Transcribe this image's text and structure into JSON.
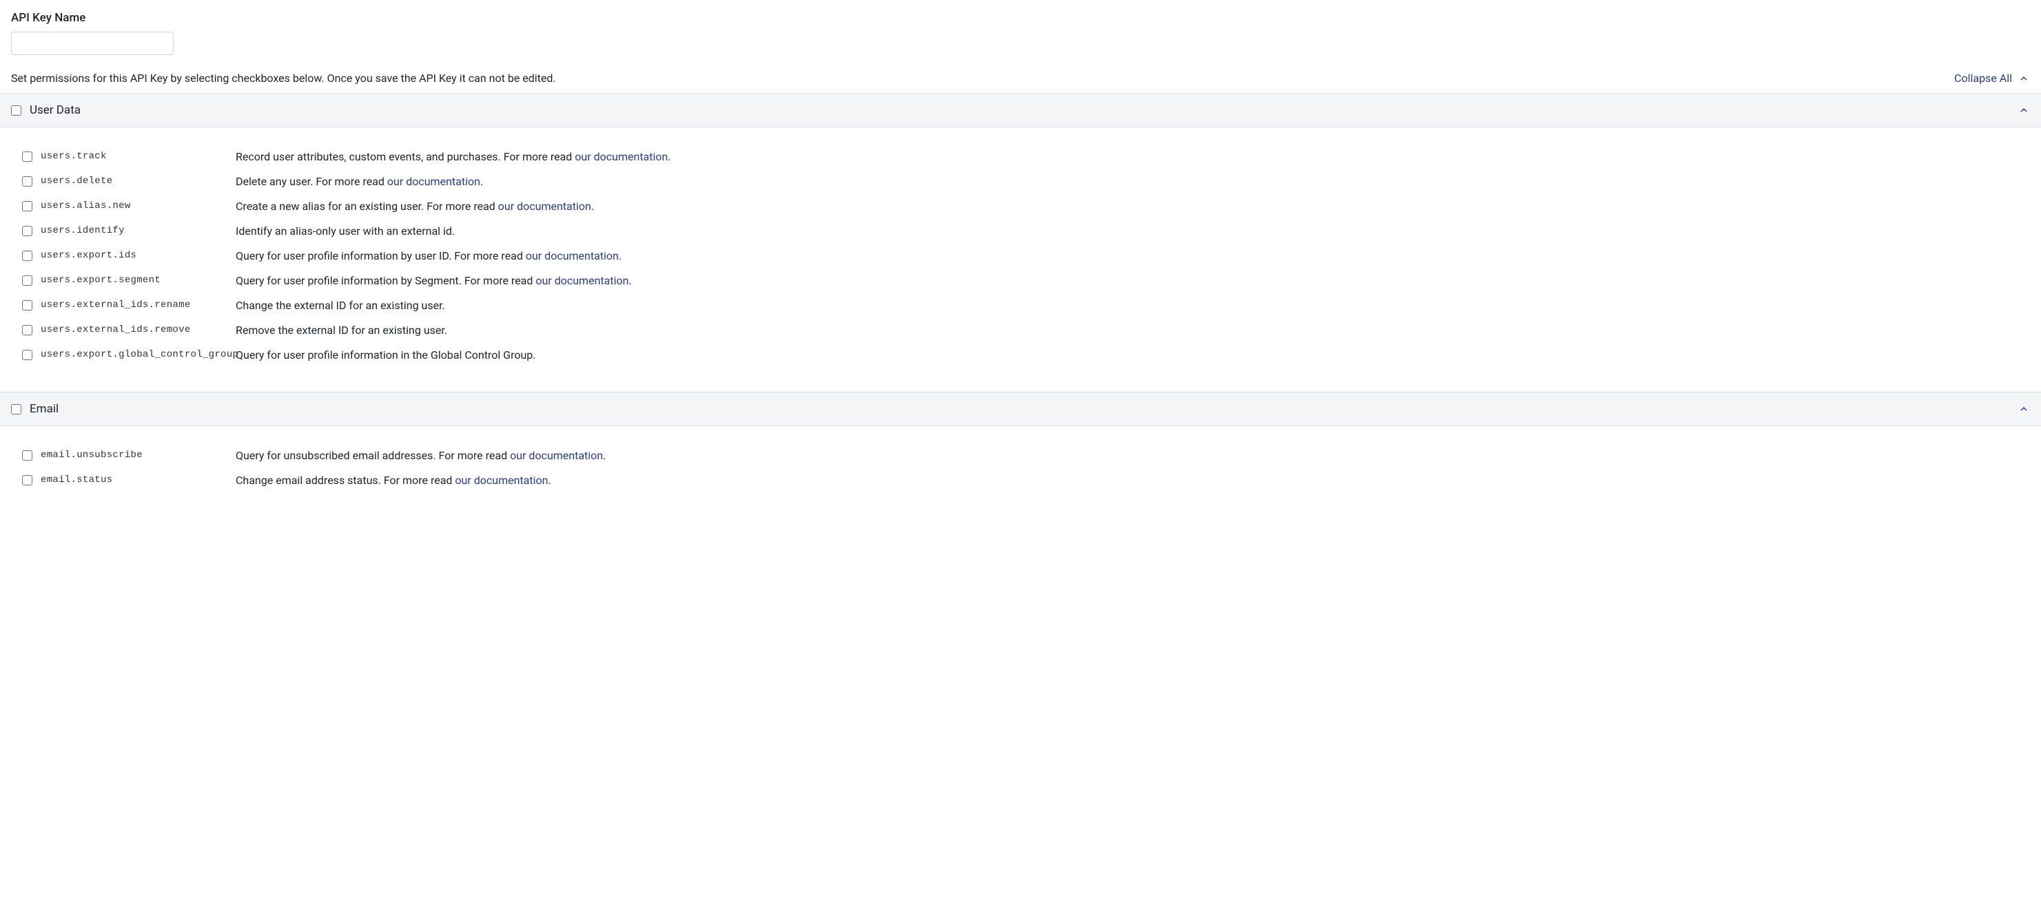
{
  "header": {
    "field_label": "API Key Name",
    "input_value": ""
  },
  "instructions": "Set permissions for this API Key by selecting checkboxes below. Once you save the API Key it can not be edited.",
  "collapse_all_label": "Collapse All",
  "link_text": "our documentation",
  "read_more_text": "For more read ",
  "sections": [
    {
      "title": "User Data",
      "checked": false,
      "expanded": true,
      "permissions": [
        {
          "code": "users.track",
          "desc_before": "Record user attributes, custom events, and purchases. ",
          "has_link": true,
          "desc_after": ".",
          "checked": false
        },
        {
          "code": "users.delete",
          "desc_before": "Delete any user. ",
          "has_link": true,
          "desc_after": ".",
          "checked": false
        },
        {
          "code": "users.alias.new",
          "desc_before": "Create a new alias for an existing user. ",
          "has_link": true,
          "desc_after": ".",
          "checked": false
        },
        {
          "code": "users.identify",
          "desc_before": "Identify an alias-only user with an external id.",
          "has_link": false,
          "desc_after": "",
          "checked": false
        },
        {
          "code": "users.export.ids",
          "desc_before": "Query for user profile information by user ID. ",
          "has_link": true,
          "desc_after": ".",
          "checked": false
        },
        {
          "code": "users.export.segment",
          "desc_before": "Query for user profile information by Segment. ",
          "has_link": true,
          "desc_after": ".",
          "checked": false
        },
        {
          "code": "users.external_ids.rename",
          "desc_before": "Change the external ID for an existing user.",
          "has_link": false,
          "desc_after": "",
          "checked": false
        },
        {
          "code": "users.external_ids.remove",
          "desc_before": "Remove the external ID for an existing user.",
          "has_link": false,
          "desc_after": "",
          "checked": false
        },
        {
          "code": "users.export.global_control_group",
          "desc_before": "Query for user profile information in the Global Control Group.",
          "has_link": false,
          "desc_after": "",
          "checked": false
        }
      ]
    },
    {
      "title": "Email",
      "checked": false,
      "expanded": true,
      "permissions": [
        {
          "code": "email.unsubscribe",
          "desc_before": "Query for unsubscribed email addresses. ",
          "has_link": true,
          "desc_after": ".",
          "checked": false
        },
        {
          "code": "email.status",
          "desc_before": "Change email address status. ",
          "has_link": true,
          "desc_after": ".",
          "checked": false
        }
      ]
    }
  ]
}
